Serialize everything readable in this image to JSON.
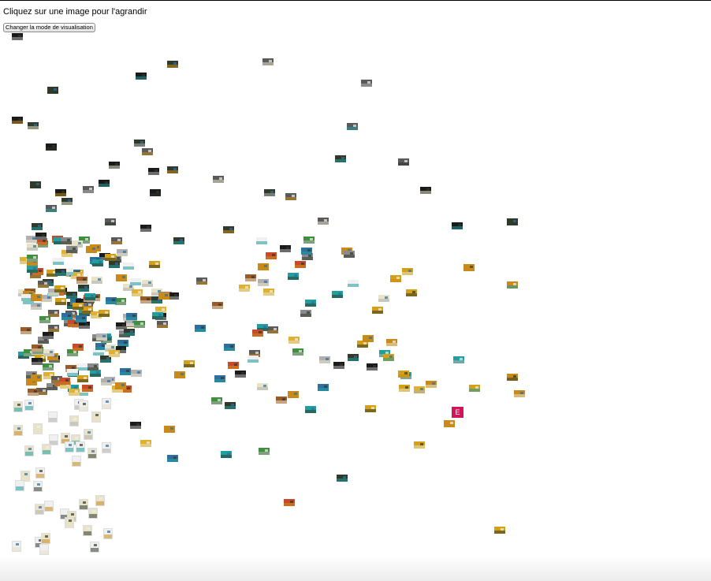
{
  "page": {
    "instruction": "Cliquez sur une image pour l'agrandir",
    "mode_button_label": "Changer la mode de visualisation",
    "badge_letter": "E"
  },
  "palette": [
    "#1a1a1a",
    "#2f3a2a",
    "#5a5a5a",
    "#8a8a8a",
    "#b0b0b0",
    "#3f8f3f",
    "#2f6f9f",
    "#c98a1a",
    "#d4a017",
    "#9a5a2a",
    "#e8e2c8",
    "#f0f0f0",
    "#c84a2a",
    "#1f9f9f",
    "#e0b030"
  ]
}
